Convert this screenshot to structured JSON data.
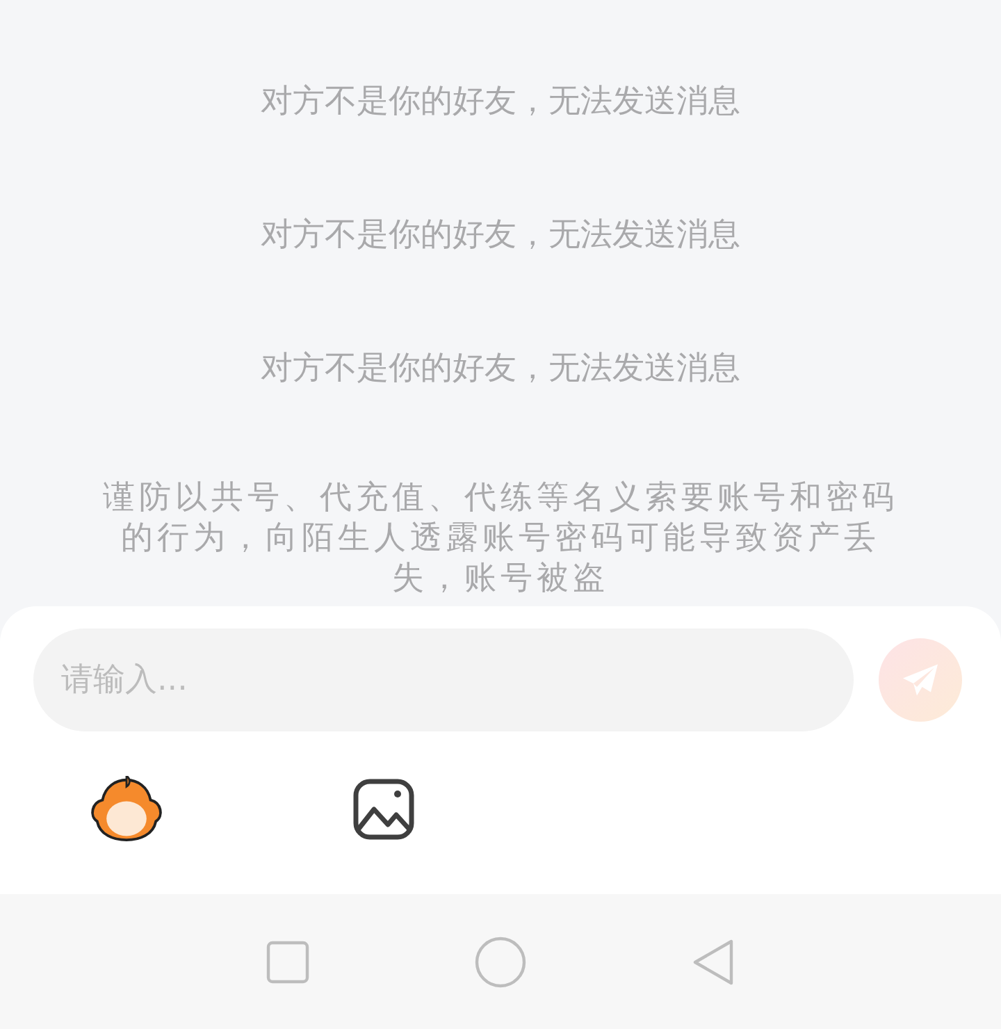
{
  "messages": [
    {
      "kind": "system",
      "text": "对方不是你的好友，无法发送消息"
    },
    {
      "kind": "system",
      "text": "对方不是你的好友，无法发送消息"
    },
    {
      "kind": "system",
      "text": "对方不是你的好友，无法发送消息"
    },
    {
      "kind": "notice",
      "text": "谨防以共号、代充值、代练等名义索要账号和密码的行为，向陌生人透露账号密码可能导致资产丢失，账号被盗"
    }
  ],
  "composer": {
    "placeholder": "请输入...",
    "send_disabled": true
  },
  "tools": [
    {
      "kind": "sticker"
    },
    {
      "kind": "image"
    }
  ],
  "nav_bar": [
    {
      "kind": "recent"
    },
    {
      "kind": "home"
    },
    {
      "kind": "back"
    }
  ]
}
